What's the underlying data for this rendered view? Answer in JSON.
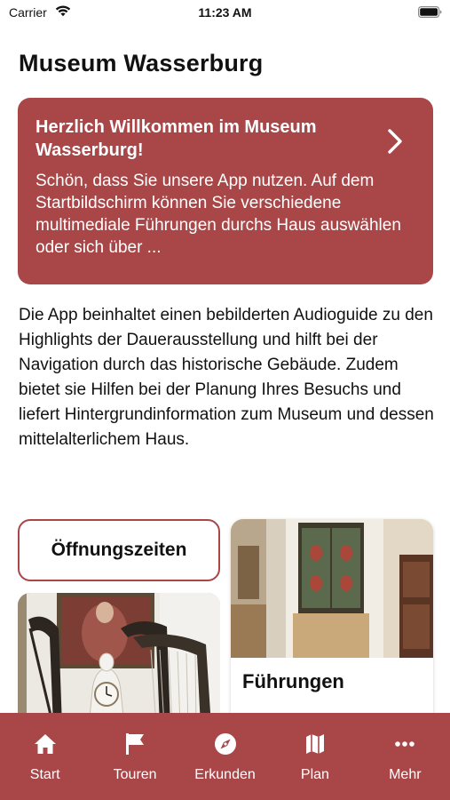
{
  "status_bar": {
    "carrier": "Carrier",
    "time": "11:23 AM"
  },
  "page": {
    "title": "Museum Wasserburg"
  },
  "welcome_card": {
    "title": "Herzlich Willkommen im Museum Wasserburg!",
    "text": "Schön, dass Sie unsere App nutzen. Auf dem Startbildschirm können Sie verschiedene multimediale Führungen durchs Haus auswählen oder sich über ..."
  },
  "intro": {
    "text": "Die App beinhaltet einen bebilderten Audioguide zu den Highlights der Dauerausstellung und hilft bei der Navigation durch das historische Gebäude. Zudem bietet sie Hilfen bei der Planung Ihres Besuchs und liefert Hintergrundinformation zum Museum und dessen mittelalterlichem Haus."
  },
  "tiles": {
    "opening_hours_label": "Öffnungszeiten",
    "tours_label": "Führungen"
  },
  "tab_bar": {
    "items": [
      {
        "label": "Start",
        "icon": "home-icon"
      },
      {
        "label": "Touren",
        "icon": "flag-icon"
      },
      {
        "label": "Erkunden",
        "icon": "compass-icon"
      },
      {
        "label": "Plan",
        "icon": "map-icon"
      },
      {
        "label": "Mehr",
        "icon": "more-icon"
      }
    ]
  },
  "colors": {
    "accent": "#a84648",
    "text": "#111111",
    "background": "#ffffff"
  }
}
